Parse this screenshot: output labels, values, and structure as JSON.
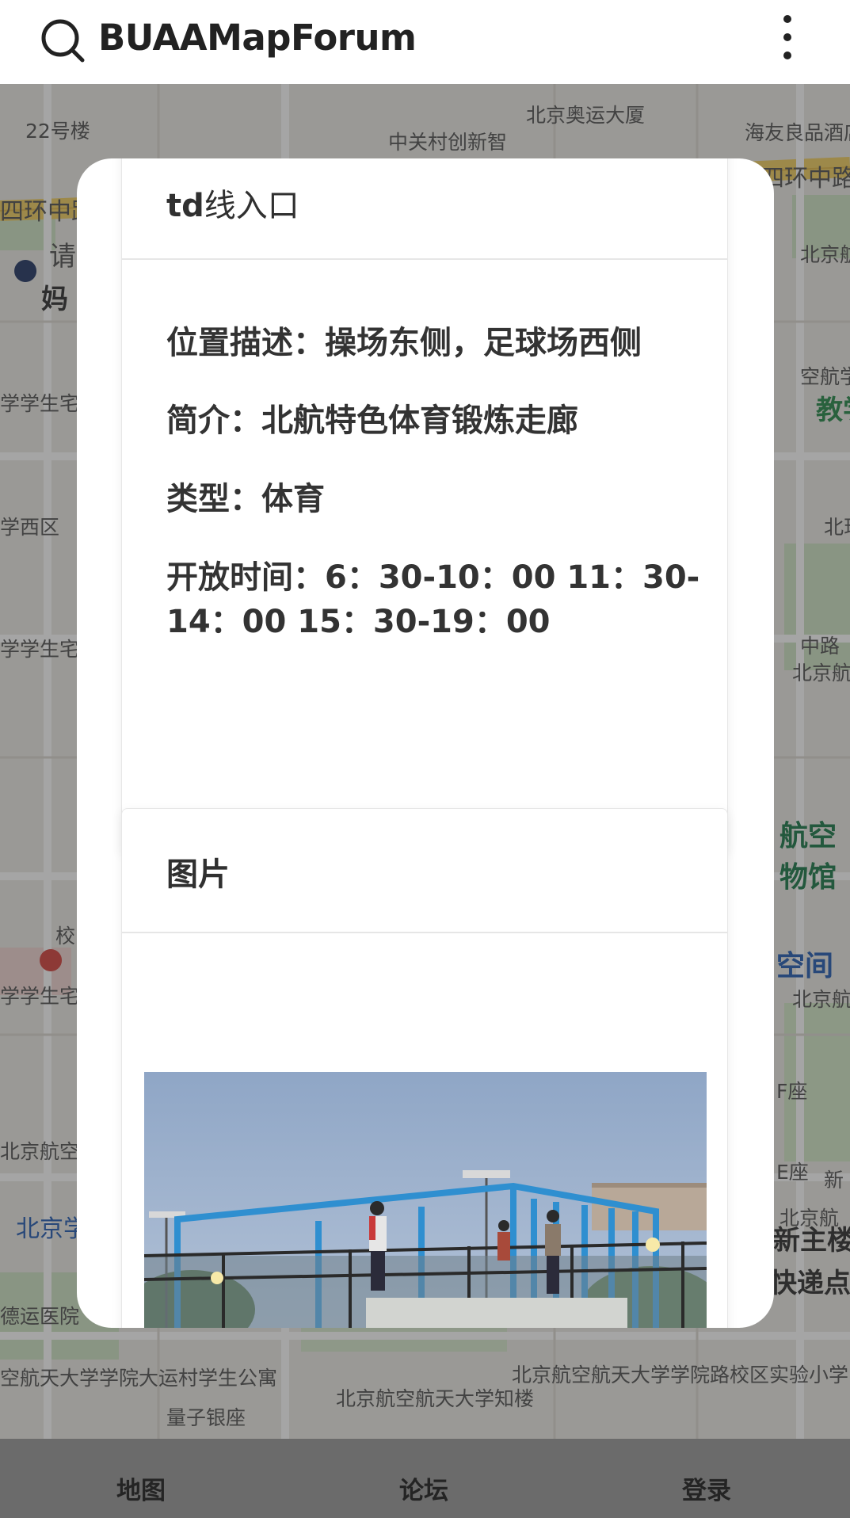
{
  "app": {
    "title": "BUAAMapForum",
    "search_icon": "search-icon",
    "more_icon": "more-vertical-icon"
  },
  "map": {
    "labels": [
      "22号楼",
      "中关村创新智库大厦",
      "北京奥运大厦",
      "海友良品酒店",
      "四环中路",
      "四环中路",
      "请",
      "妈",
      "学学生宅",
      "学西区",
      "学学生宅",
      "校",
      "学学生宅",
      "北京航空航天大学院路校区",
      "北京学院路",
      "德运医院",
      "空航天大学学院大运村学生公寓",
      "量子银座",
      "北京航空航天大学知楼",
      "北京航空航天大学学院路校区实验小学",
      "北京航天大学第三",
      "空航学",
      "教学",
      "北现",
      "中路",
      "北京航空航天大学法工程",
      "航空物馆",
      "空间",
      "北京航空航天大学体育馆",
      "F座",
      "E座",
      "新",
      "北京航",
      "新主楼",
      "快递点"
    ]
  },
  "modal": {
    "header_bold": "td",
    "header_rest": "线入口",
    "info": {
      "location": "位置描述：操场东侧，足球场西侧",
      "intro": "简介：北航特色体育锻炼走廊",
      "type": "类型：体育",
      "hours": "开放时间：6：30-10：00 11：30-14：00 15：30-19：00"
    },
    "pictures_title": "图片"
  },
  "bottom_nav": {
    "map": "地图",
    "forum": "论坛",
    "login": "登录"
  }
}
